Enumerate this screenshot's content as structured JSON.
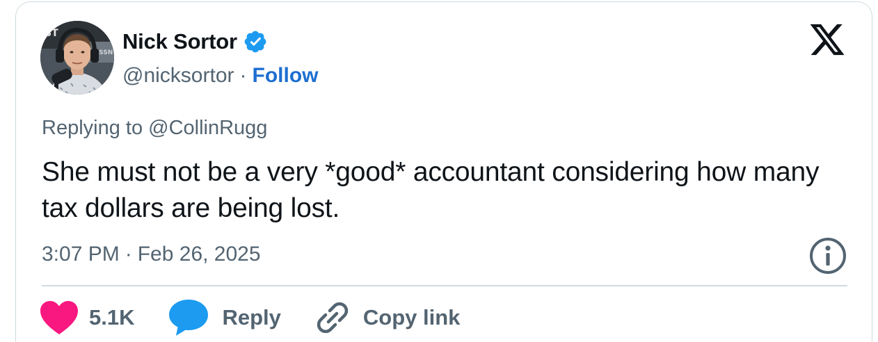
{
  "author": {
    "name": "Nick Sortor",
    "handle": "@nicksortor",
    "separator": "·",
    "follow_label": "Follow",
    "verified_icon": "verified-badge-icon",
    "verified_color": "#1d9bf0"
  },
  "tweet": {
    "replying_to": "Replying to @CollinRugg",
    "text": "She must not be a very *good* accountant considering how many tax dollars are being lost.",
    "time": "3:07 PM",
    "separator": "·",
    "date": "Feb 26, 2025"
  },
  "actions": {
    "like_count": "5.1K",
    "reply_label": "Reply",
    "copy_link_label": "Copy link",
    "like_color": "#f91880",
    "reply_color": "#1d9bf0"
  },
  "icons": {
    "brand": "x-logo-icon",
    "info": "info-icon",
    "like": "heart-icon",
    "reply": "speech-bubble-icon",
    "copy": "link-icon"
  },
  "colors": {
    "text_primary": "#0f1419",
    "text_secondary": "#536471",
    "link": "#1d6fd1",
    "border": "#cfd9de"
  }
}
